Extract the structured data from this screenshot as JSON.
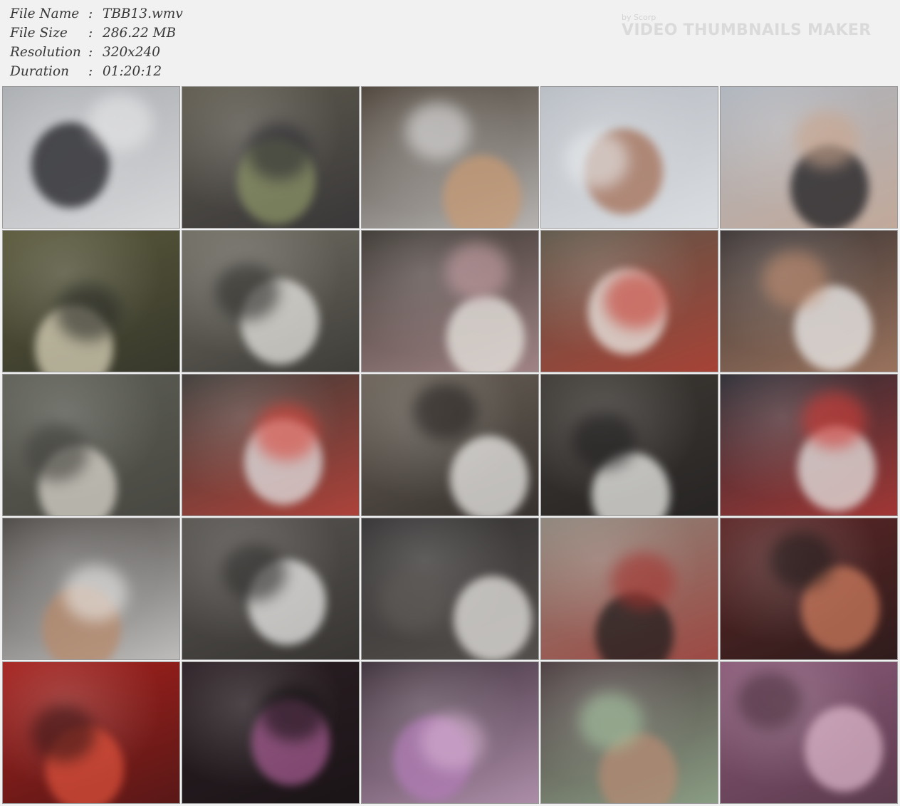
{
  "header": {
    "rows": [
      {
        "key": "File Name",
        "sep": ":",
        "value": "TBB13.wmv"
      },
      {
        "key": "File Size",
        "sep": ":",
        "value": "286.22 MB"
      },
      {
        "key": "Resolution",
        "sep": ":",
        "value": "320x240"
      },
      {
        "key": "Duration",
        "sep": ":",
        "value": "01:20:12"
      }
    ]
  },
  "watermark": {
    "by": "by Scorp",
    "title": "VIDEO THUMBNAILS MAKER"
  },
  "thumbnails": [
    {
      "bg": "#a9acb0",
      "accent": "#1e1e22",
      "accent2": "#e9e9ea"
    },
    {
      "bg": "#5e5a4e",
      "accent": "#8a9266",
      "accent2": "#2b2a30"
    },
    {
      "bg": "#4b4238",
      "accent": "#c79a74",
      "accent2": "#dfdfe0"
    },
    {
      "bg": "#b7bcc3",
      "accent": "#a46f57",
      "accent2": "#e8eaec"
    },
    {
      "bg": "#aeb4bd",
      "accent": "#1c1c20",
      "accent2": "#c9a48c"
    },
    {
      "bg": "#59583a",
      "accent": "#d9d2b8",
      "accent2": "#2a2b26"
    },
    {
      "bg": "#6f6c62",
      "accent": "#e7e5e0",
      "accent2": "#2c2b28"
    },
    {
      "bg": "#3b3731",
      "accent": "#e9e7e1",
      "accent2": "#c9a1a7"
    },
    {
      "bg": "#5d5648",
      "accent": "#ecebe6",
      "accent2": "#c43a2f"
    },
    {
      "bg": "#3a3434",
      "accent": "#eeeeee",
      "accent2": "#c08b6d"
    },
    {
      "bg": "#5d5e55",
      "accent": "#d9d6cc",
      "accent2": "#403f3a"
    },
    {
      "bg": "#3e3b37",
      "accent": "#e2e2e3",
      "accent2": "#d8453b"
    },
    {
      "bg": "#6a6258",
      "accent": "#ecebe8",
      "accent2": "#241f1e"
    },
    {
      "bg": "#3d3934",
      "accent": "#eeeeea",
      "accent2": "#1e1c1d"
    },
    {
      "bg": "#2c2c33",
      "accent": "#e6e5e3",
      "accent2": "#d03b36"
    },
    {
      "bg": "#4a4744",
      "accent": "#b88a6b",
      "accent2": "#ecebea"
    },
    {
      "bg": "#575450",
      "accent": "#ecebe9",
      "accent2": "#2c2a28"
    },
    {
      "bg": "#333131",
      "accent": "#e7e5e1",
      "accent2": "#5f5a56"
    },
    {
      "bg": "#8d8479",
      "accent": "#1f1d1d",
      "accent2": "#a3322e"
    },
    {
      "bg": "#5c2626",
      "accent": "#cc7a5c",
      "accent2": "#1e1818"
    },
    {
      "bg": "#a5201c",
      "accent": "#d94f3a",
      "accent2": "#3a1515"
    },
    {
      "bg": "#2a1f24",
      "accent": "#a25a8e",
      "accent2": "#151012"
    },
    {
      "bg": "#3d2f3a",
      "accent": "#b17cb6",
      "accent2": "#d9b3d4"
    },
    {
      "bg": "#4a3b3e",
      "accent": "#b58a73",
      "accent2": "#a4c49f"
    },
    {
      "bg": "#8a5a78",
      "accent": "#dcb5c9",
      "accent2": "#4a2f3d"
    }
  ]
}
